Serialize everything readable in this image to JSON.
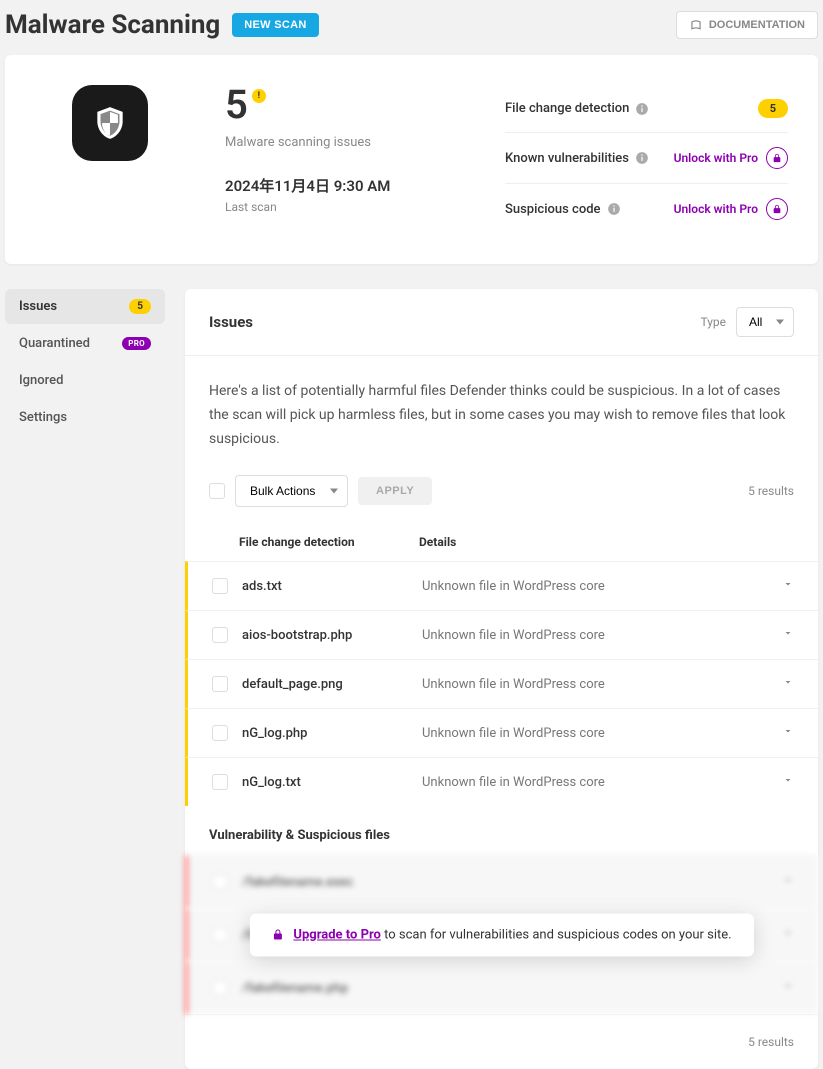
{
  "header": {
    "title": "Malware Scanning",
    "new_scan": "NEW SCAN",
    "documentation": "DOCUMENTATION"
  },
  "summary": {
    "count": "5",
    "count_label": "Malware scanning issues",
    "last_scan_time": "2024年11月4日 9:30 AM",
    "last_scan_label": "Last scan",
    "stats": {
      "file_change": {
        "label": "File change detection",
        "badge": "5"
      },
      "known_vuln": {
        "label": "Known vulnerabilities",
        "action": "Unlock with Pro"
      },
      "suspicious": {
        "label": "Suspicious code",
        "action": "Unlock with Pro"
      }
    }
  },
  "sidebar": {
    "issues": {
      "label": "Issues",
      "badge": "5"
    },
    "quarantined": {
      "label": "Quarantined",
      "badge": "PRO"
    },
    "ignored": {
      "label": "Ignored"
    },
    "settings": {
      "label": "Settings"
    }
  },
  "panel": {
    "title": "Issues",
    "type_label": "Type",
    "type_value": "All",
    "description": "Here's a list of potentially harmful files Defender thinks could be suspicious. In a lot of cases the scan will pick up harmless files, but in some cases you may wish to remove files that look suspicious.",
    "bulk_actions": "Bulk Actions",
    "apply": "APPLY",
    "results_top": "5 results",
    "columns": {
      "file": "File change detection",
      "details": "Details"
    },
    "issues": [
      {
        "file": "ads.txt",
        "details": "Unknown file in WordPress core"
      },
      {
        "file": "aios-bootstrap.php",
        "details": "Unknown file in WordPress core"
      },
      {
        "file": "default_page.png",
        "details": "Unknown file in WordPress core"
      },
      {
        "file": "nG_log.php",
        "details": "Unknown file in WordPress core"
      },
      {
        "file": "nG_log.txt",
        "details": "Unknown file in WordPress core"
      }
    ],
    "vuln_title": "Vulnerability & Suspicious files",
    "blurred": [
      {
        "file": "/fakefilename.exec"
      },
      {
        "file": "/fakefilename.sss"
      },
      {
        "file": "/fakefilename.php"
      }
    ],
    "upgrade": {
      "link": "Upgrade to Pro",
      "text": " to scan for vulnerabilities and suspicious codes on your site."
    },
    "results_bottom": "5 results"
  }
}
